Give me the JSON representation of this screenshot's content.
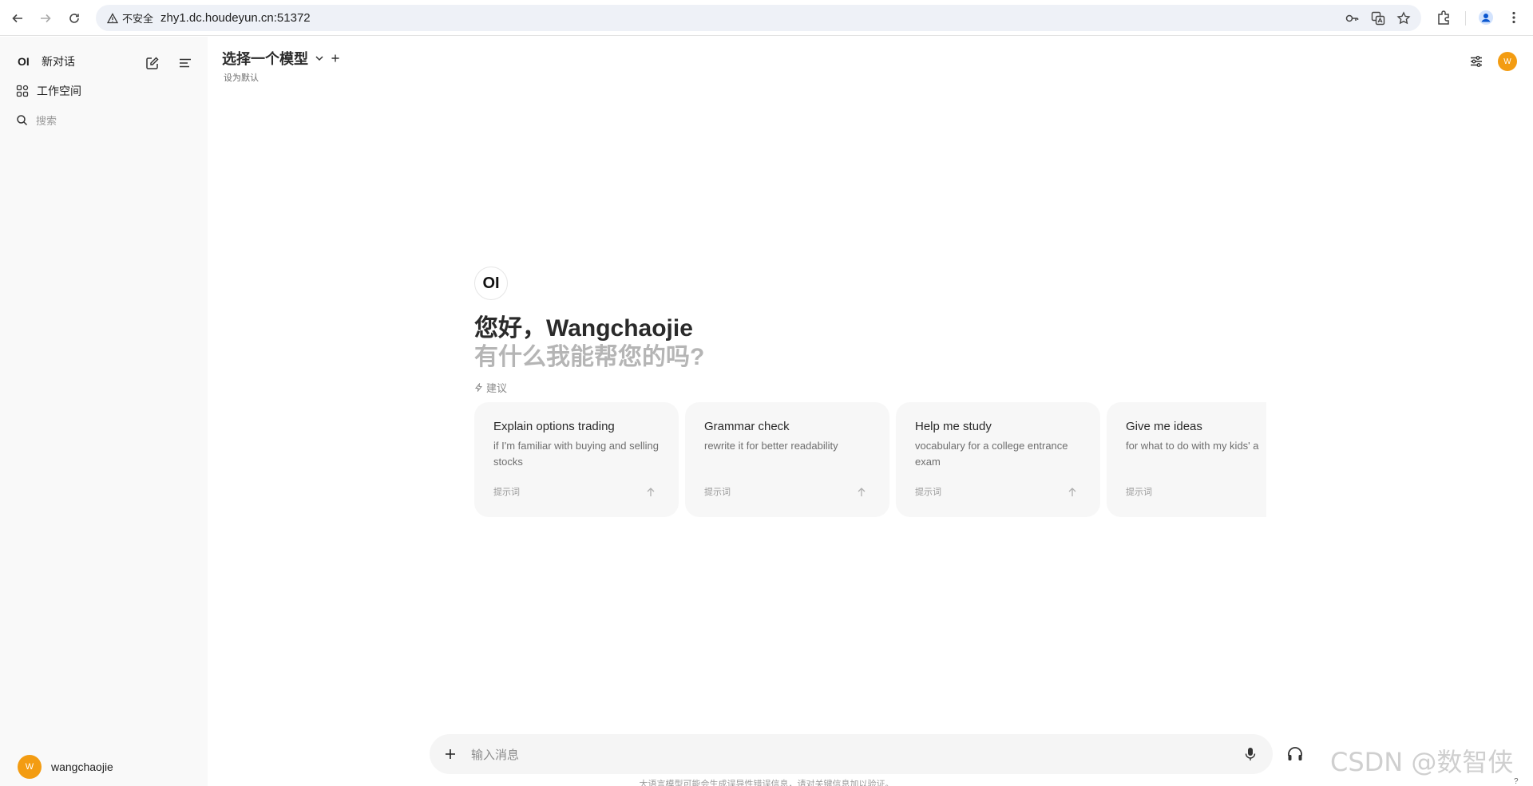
{
  "browser": {
    "security_label": "不安全",
    "url": "zhy1.dc.houdeyun.cn:51372"
  },
  "sidebar": {
    "logo": "OI",
    "new_chat": "新对话",
    "workspace": "工作空间",
    "search_placeholder": "搜索",
    "user_initial": "W",
    "user_name": "wangchaojie"
  },
  "header": {
    "model_select": "选择一个模型",
    "set_default": "设为默认",
    "user_initial": "W"
  },
  "greeting": {
    "logo": "OI",
    "title": "您好，Wangchaojie",
    "subtitle": "有什么我能帮您的吗?",
    "suggest_label": "建议"
  },
  "suggestions": [
    {
      "title": "Explain options trading",
      "subtitle": "if I'm familiar with buying and selling stocks",
      "tag": "提示词"
    },
    {
      "title": "Grammar check",
      "subtitle": "rewrite it for better readability",
      "tag": "提示词"
    },
    {
      "title": "Help me study",
      "subtitle": "vocabulary for a college entrance exam",
      "tag": "提示词"
    },
    {
      "title": "Give me ideas",
      "subtitle": "for what to do with my kids' a",
      "tag": "提示词"
    }
  ],
  "composer": {
    "placeholder": "输入消息"
  },
  "footer": {
    "disclaimer": "大语言模型可能会生成误导性错误信息，请对关键信息加以验证。",
    "help": "?"
  },
  "watermark": "CSDN @数智侠",
  "colors": {
    "accent_avatar": "#f39c12",
    "sidebar_bg": "#f9f9f9",
    "card_bg": "#f7f7f7"
  }
}
